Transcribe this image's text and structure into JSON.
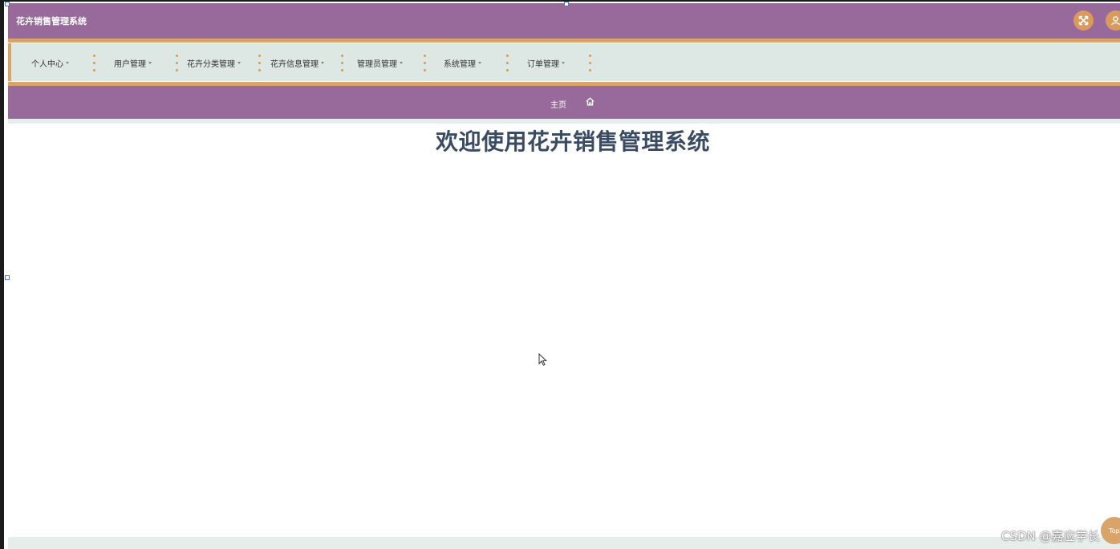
{
  "app": {
    "title": "花卉销售管理系统"
  },
  "header": {
    "fullscreen_icon": "expand-arrows-icon",
    "user_icon": "user-icon"
  },
  "nav": {
    "items": [
      {
        "label": "个人中心"
      },
      {
        "label": "用户管理"
      },
      {
        "label": "花卉分类管理"
      },
      {
        "label": "花卉信息管理"
      },
      {
        "label": "管理员管理"
      },
      {
        "label": "系统管理"
      },
      {
        "label": "订单管理"
      }
    ]
  },
  "breadcrumb": {
    "home_label": "主页",
    "home_icon": "home-icon"
  },
  "main": {
    "welcome": "欢迎使用花卉销售管理系统"
  },
  "back_to_top": {
    "label": "Top"
  },
  "watermark": {
    "text": "CSDN @嘉应学长"
  },
  "colors": {
    "header": "#98699b",
    "accent": "#d9a46a",
    "nav_bg": "#dde7e4",
    "heading": "#3a4c63"
  }
}
